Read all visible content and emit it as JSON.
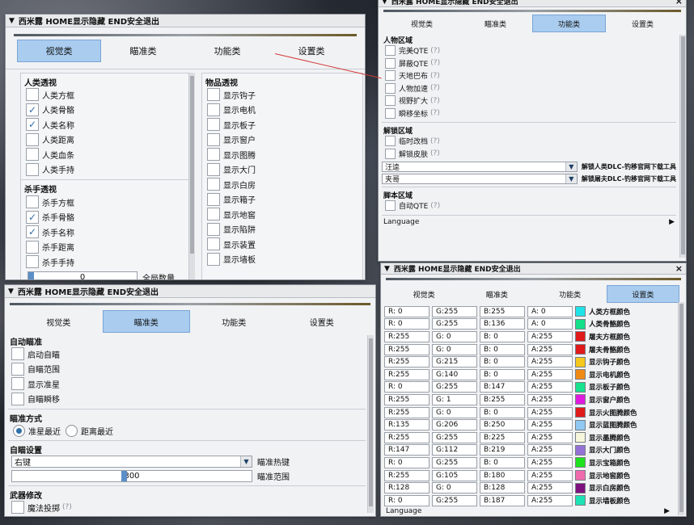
{
  "window_title": "西米露 HOME显示隐藏 END安全退出",
  "tabs": [
    "视觉类",
    "瞄准类",
    "功能类",
    "设置类"
  ],
  "visual": {
    "human": {
      "title": "人类透视",
      "items": [
        {
          "label": "人类方框",
          "checked": false
        },
        {
          "label": "人类骨骼",
          "checked": true
        },
        {
          "label": "人类名称",
          "checked": true
        },
        {
          "label": "人类距离",
          "checked": false
        },
        {
          "label": "人类血条",
          "checked": false
        },
        {
          "label": "人类手持",
          "checked": false
        }
      ]
    },
    "killer": {
      "title": "杀手透视",
      "items": [
        {
          "label": "杀手方框",
          "checked": false
        },
        {
          "label": "杀手骨骼",
          "checked": true
        },
        {
          "label": "杀手名称",
          "checked": true
        },
        {
          "label": "杀手距离",
          "checked": false
        },
        {
          "label": "杀手手持",
          "checked": false
        }
      ]
    },
    "slider_value": "0",
    "partial_label": "全局数量",
    "objects": {
      "title": "物品透视",
      "items": [
        "显示钩子",
        "显示电机",
        "显示板子",
        "显示窗户",
        "显示图腾",
        "显示大门",
        "显示白房",
        "显示箱子",
        "显示地窖",
        "显示陷阱",
        "显示装置",
        "显示墙板"
      ]
    }
  },
  "function": {
    "char_title": "人物区域",
    "char_items": [
      {
        "label": "完美QTE",
        "help": "(?)"
      },
      {
        "label": "屏蔽QTE",
        "help": "(?)"
      },
      {
        "label": "天地巴布",
        "help": "(?)"
      },
      {
        "label": "人物加速",
        "help": "(?)"
      },
      {
        "label": "视野扩大",
        "help": "(?)"
      },
      {
        "label": "瞬移坐标",
        "help": "(?)"
      }
    ],
    "unlock_title": "解锁区域",
    "unlock_items": [
      {
        "label": "临时改档",
        "help": "(?)"
      },
      {
        "label": "解锁皮肤",
        "help": "(?)"
      }
    ],
    "combo1": {
      "value": "汪逵",
      "label": "解锁人类DLC-钓移官网下载工具"
    },
    "combo2": {
      "value": "夹哥",
      "label": "解锁屠夫DLC-钓移官网下载工具"
    },
    "script_title": "脚本区域",
    "script_items": [
      {
        "label": "自动QTE",
        "help": "(?)"
      }
    ],
    "language": "Language"
  },
  "aim": {
    "auto_title": "自动瞄准",
    "auto_items": [
      "启动自瞄",
      "自瞄范围",
      "显示准星",
      "自瞄瞬移"
    ],
    "mode_title": "瞄准方式",
    "modes": [
      {
        "label": "准星最近",
        "selected": true
      },
      {
        "label": "距离最近",
        "selected": false
      }
    ],
    "settings_title": "自瞄设置",
    "hotkey_value": "右键",
    "hotkey_label": "瞄准热键",
    "range_value": "300",
    "range_fraction": 0.47,
    "range_label": "瞄准范围",
    "weapon_title": "武器修改",
    "weapon_items": [
      {
        "label": "魔法投掷",
        "help": "(?)"
      }
    ]
  },
  "settings": {
    "colors": [
      {
        "r": "R:  0",
        "g": "G:255",
        "b": "B:255",
        "a": "A:  0",
        "color": "#1fe3e6",
        "label": "人类方框颜色"
      },
      {
        "r": "R:  0",
        "g": "G:255",
        "b": "B:136",
        "a": "A:  0",
        "color": "#14e08a",
        "label": "人类骨骼颜色"
      },
      {
        "r": "R:255",
        "g": "G:  0",
        "b": "B:  0",
        "a": "A:255",
        "color": "#e01a1a",
        "label": "屠夫方框颜色"
      },
      {
        "r": "R:255",
        "g": "G:  0",
        "b": "B:  0",
        "a": "A:255",
        "color": "#e01a1a",
        "label": "屠夫骨骼颜色"
      },
      {
        "r": "R:255",
        "g": "G:215",
        "b": "B:  0",
        "a": "A:255",
        "color": "#f4c81c",
        "label": "显示钩子颜色"
      },
      {
        "r": "R:255",
        "g": "G:140",
        "b": "B:  0",
        "a": "A:255",
        "color": "#f08a14",
        "label": "显示电机颜色"
      },
      {
        "r": "R:  0",
        "g": "G:255",
        "b": "B:147",
        "a": "A:255",
        "color": "#18e28e",
        "label": "显示板子颜色"
      },
      {
        "r": "R:255",
        "g": "G:  1",
        "b": "B:255",
        "a": "A:255",
        "color": "#e11ae0",
        "label": "显示窗户颜色"
      },
      {
        "r": "R:255",
        "g": "G:  0",
        "b": "B:  0",
        "a": "A:255",
        "color": "#e01a1a",
        "label": "显示火图腾颜色"
      },
      {
        "r": "R:135",
        "g": "G:206",
        "b": "B:250",
        "a": "A:255",
        "color": "#8fc9f3",
        "label": "显示蓝图腾颜色"
      },
      {
        "r": "R:255",
        "g": "G:255",
        "b": "B:225",
        "a": "A:255",
        "color": "#f6f6da",
        "label": "显示墨腾颜色"
      },
      {
        "r": "R:147",
        "g": "G:112",
        "b": "B:219",
        "a": "A:255",
        "color": "#9471d6",
        "label": "显示大门颜色"
      },
      {
        "r": "R:  0",
        "g": "G:255",
        "b": "B:  0",
        "a": "A:255",
        "color": "#1de21d",
        "label": "显示宝箱颜色"
      },
      {
        "r": "R:255",
        "g": "G:105",
        "b": "B:180",
        "a": "A:255",
        "color": "#f06aae",
        "label": "显示地窖颜色"
      },
      {
        "r": "R:128",
        "g": "G:  0",
        "b": "B:128",
        "a": "A:255",
        "color": "#7d107d",
        "label": "显示白房颜色"
      },
      {
        "r": "R:  0",
        "g": "G:255",
        "b": "B:187",
        "a": "A:255",
        "color": "#1ce2b4",
        "label": "显示墙板颜色"
      }
    ],
    "language": "Language"
  }
}
